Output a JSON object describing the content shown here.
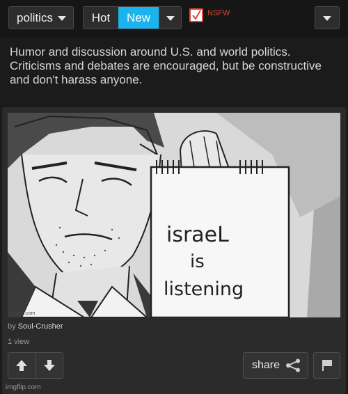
{
  "toolbar": {
    "category": "politics",
    "sort_hot": "Hot",
    "sort_new": "New",
    "nsfw_label": "NSFW",
    "nsfw_checked": true
  },
  "description": "Humor and discussion around U.S. and world politics. Criticisms and debates are encouraged, but be constructive and don't harass anyone.",
  "post": {
    "image_text": [
      "israeL",
      "is",
      "listening"
    ],
    "image_watermark": "imgflip.com",
    "by_prefix": "by",
    "author": "Soul-Crusher",
    "views": "1 view",
    "share_label": "share"
  },
  "footer": "imgflip.com",
  "colors": {
    "accent": "#1ab3ee",
    "nsfw": "#e0443a",
    "background": "#1b1b1b",
    "card": "#2b2b2b"
  }
}
